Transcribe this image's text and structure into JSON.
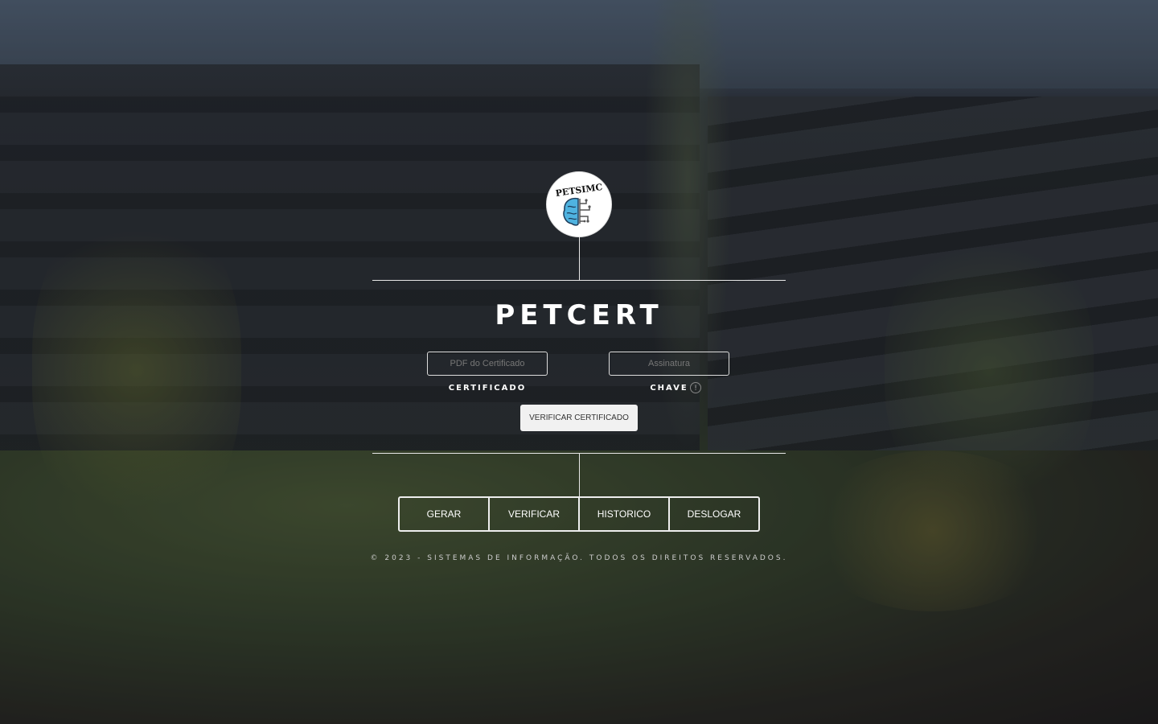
{
  "brand": {
    "logo_text": "PETSIMC",
    "title": "PETCERT"
  },
  "form": {
    "certificate": {
      "placeholder": "PDF do Certificado",
      "label": "CERTIFICADO"
    },
    "key": {
      "placeholder": "Assinatura",
      "label": "CHAVE",
      "info_glyph": "!"
    },
    "verify_button": "VERIFICAR CERTIFICADO"
  },
  "nav": {
    "items": [
      {
        "label": "GERAR"
      },
      {
        "label": "VERIFICAR"
      },
      {
        "label": "HISTORICO"
      },
      {
        "label": "DESLOGAR"
      }
    ]
  },
  "footer": {
    "text": "© 2023 - SISTEMAS DE INFORMAÇÃO. TODOS OS DIREITOS RESERVADOS."
  },
  "colors": {
    "line": "#e8e8e8",
    "button_bg": "#f1f1f1",
    "text": "#ffffff"
  }
}
